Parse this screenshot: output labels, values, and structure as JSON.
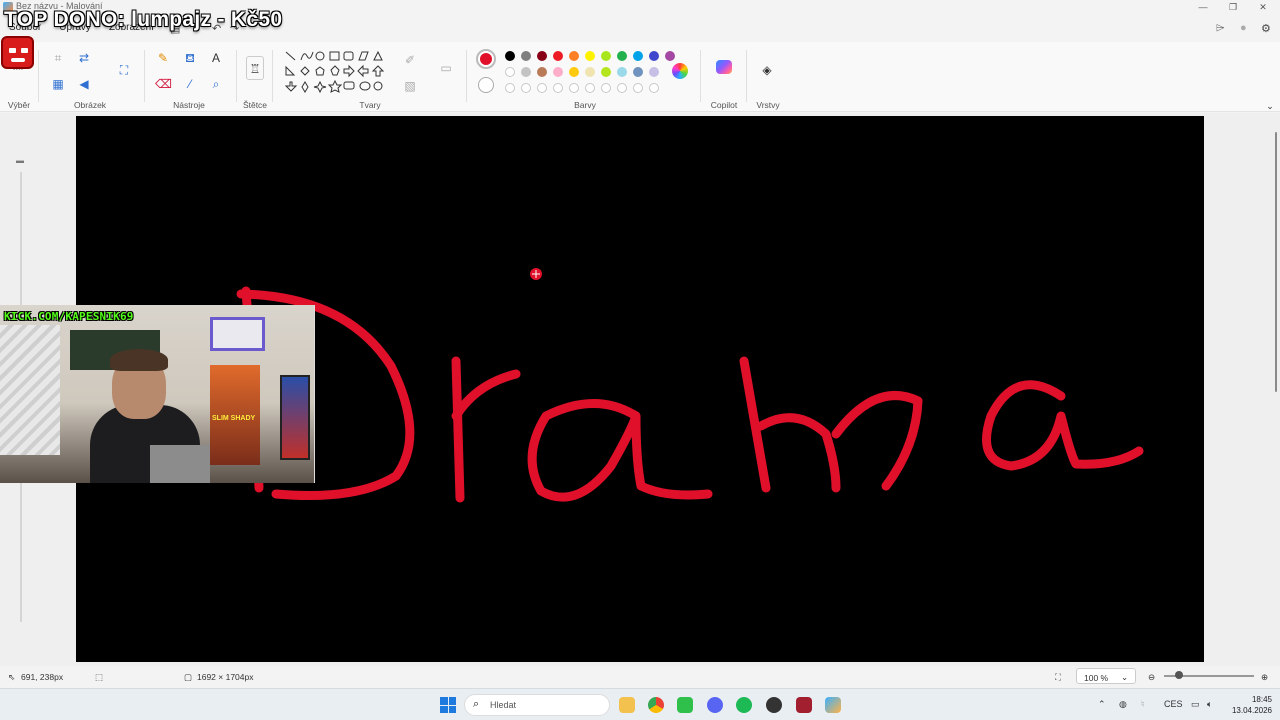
{
  "window": {
    "title": "Bez názvu - Malování",
    "app": "Malování"
  },
  "overlay": {
    "top_donation": "TOP DONO: lumpajz - Kč50",
    "channel_tag": "KICK.COM/KAPESNIK69"
  },
  "menu": {
    "items": [
      "Soubor",
      "Úpravy",
      "Zobrazení"
    ]
  },
  "ribbon": {
    "groups": [
      "Výběr",
      "Obrázek",
      "Nástroje",
      "Štětce",
      "Tvary",
      "Barvy",
      "Copilot",
      "Vrstvy"
    ],
    "active_color": "#e0102a",
    "palette_row1": [
      "#000000",
      "#7f7f7f",
      "#880015",
      "#ed1c24",
      "#ff7f27",
      "#fff200",
      "#a8e61d",
      "#22b14c",
      "#00a2e8",
      "#3f48cc",
      "#a349a4"
    ],
    "palette_row2": [
      "#ffffff",
      "#c3c3c3",
      "#b97a57",
      "#ffaec9",
      "#ffc90e",
      "#efe4b0",
      "#b5e61d",
      "#99d9ea",
      "#7092be",
      "#c8bfe7"
    ]
  },
  "canvas": {
    "drawn_text": "Drama",
    "background": "#000000",
    "stroke_color": "#e0102a"
  },
  "webcam": {
    "poster_text": "SLIM SHADY"
  },
  "status": {
    "cursor": "691, 238px",
    "dimensions": "1692 × 1704px",
    "zoom": "100 %"
  },
  "taskbar": {
    "search_placeholder": "Hledat",
    "language": "CES",
    "time": "18:45",
    "date": "13.04.2026"
  }
}
